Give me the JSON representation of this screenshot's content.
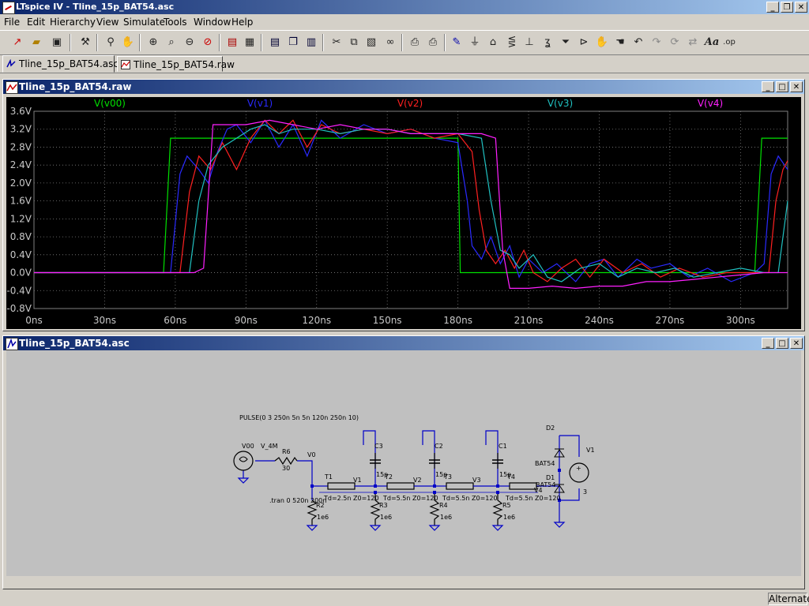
{
  "window": {
    "title": "LTspice IV - Tline_15p_BAT54.asc"
  },
  "menu": [
    "File",
    "Edit",
    "Hierarchy",
    "View",
    "Simulate",
    "Tools",
    "Window",
    "Help"
  ],
  "toolbar_icons": [
    "new-schematic-icon",
    "open-icon",
    "save-icon",
    "control-panel-icon",
    "run-icon",
    "halt-icon",
    "zoom-in-icon",
    "zoom-pan-icon",
    "zoom-out-icon",
    "zoom-full-icon",
    "autorange-icon",
    "grid-icon",
    "tile-horizontal-icon",
    "cascade-icon",
    "tile-vertical-icon",
    "cut-icon",
    "copy-icon",
    "paste-icon",
    "find-icon",
    "print-setup-icon",
    "print-icon",
    "draw-wire-icon",
    "ground-icon",
    "label-net-icon",
    "resistor-icon",
    "capacitor-icon",
    "inductor-icon",
    "diode-icon",
    "component-icon",
    "move-icon",
    "drag-icon",
    "undo-icon",
    "redo-icon",
    "rotate-icon",
    "mirror-icon",
    "text-icon",
    "spice-directive-icon"
  ],
  "tabs": [
    {
      "label": "Tline_15p_BAT54.asc",
      "active": true
    },
    {
      "label": "Tline_15p_BAT54.raw",
      "active": false
    }
  ],
  "plot_window": {
    "title": "Tline_15p_BAT54.raw"
  },
  "schematic_window": {
    "title": "Tline_15p_BAT54.asc"
  },
  "chart_data": {
    "type": "line",
    "x_unit": "ns",
    "xlim": [
      0,
      320
    ],
    "ylim": [
      -0.8,
      3.6
    ],
    "x_ticks": [
      "0ns",
      "30ns",
      "60ns",
      "90ns",
      "120ns",
      "150ns",
      "180ns",
      "210ns",
      "240ns",
      "270ns",
      "300ns"
    ],
    "y_ticks": [
      "3.6V",
      "3.2V",
      "2.8V",
      "2.4V",
      "2.0V",
      "1.6V",
      "1.2V",
      "0.8V",
      "0.4V",
      "0.0V",
      "-0.4V",
      "-0.8V"
    ],
    "grid": true,
    "legend_position": "top",
    "series": [
      {
        "name": "V(v00)",
        "color": "#00e000",
        "points": [
          [
            0,
            0
          ],
          [
            55,
            0
          ],
          [
            58,
            3.0
          ],
          [
            180,
            3.0
          ],
          [
            181,
            0
          ],
          [
            306,
            0
          ],
          [
            309,
            3.0
          ],
          [
            320,
            3.0
          ]
        ]
      },
      {
        "name": "V(v1)",
        "color": "#2a2aff",
        "points": [
          [
            0,
            0
          ],
          [
            58,
            0
          ],
          [
            62,
            2.2
          ],
          [
            65,
            2.6
          ],
          [
            70,
            2.3
          ],
          [
            74,
            2.0
          ],
          [
            78,
            2.7
          ],
          [
            82,
            3.2
          ],
          [
            86,
            3.3
          ],
          [
            92,
            2.9
          ],
          [
            98,
            3.4
          ],
          [
            104,
            2.8
          ],
          [
            110,
            3.3
          ],
          [
            116,
            2.6
          ],
          [
            122,
            3.4
          ],
          [
            130,
            3.0
          ],
          [
            140,
            3.3
          ],
          [
            150,
            3.1
          ],
          [
            160,
            3.2
          ],
          [
            170,
            3.0
          ],
          [
            180,
            2.9
          ],
          [
            184,
            1.6
          ],
          [
            186,
            0.6
          ],
          [
            190,
            0.3
          ],
          [
            194,
            0.8
          ],
          [
            198,
            0.2
          ],
          [
            202,
            0.6
          ],
          [
            206,
            -0.1
          ],
          [
            210,
            0.3
          ],
          [
            216,
            0.0
          ],
          [
            222,
            0.2
          ],
          [
            230,
            -0.2
          ],
          [
            236,
            0.2
          ],
          [
            242,
            0.3
          ],
          [
            248,
            -0.1
          ],
          [
            256,
            0.3
          ],
          [
            262,
            0.1
          ],
          [
            270,
            0.2
          ],
          [
            278,
            -0.1
          ],
          [
            286,
            0.1
          ],
          [
            296,
            -0.2
          ],
          [
            306,
            0.0
          ],
          [
            310,
            0.2
          ],
          [
            313,
            2.2
          ],
          [
            316,
            2.6
          ],
          [
            320,
            2.3
          ]
        ]
      },
      {
        "name": "V(v2)",
        "color": "#ff2020",
        "points": [
          [
            0,
            0
          ],
          [
            62,
            0
          ],
          [
            66,
            1.8
          ],
          [
            70,
            2.6
          ],
          [
            75,
            2.3
          ],
          [
            80,
            2.9
          ],
          [
            86,
            2.3
          ],
          [
            92,
            3.0
          ],
          [
            98,
            3.4
          ],
          [
            104,
            3.1
          ],
          [
            110,
            3.4
          ],
          [
            116,
            2.8
          ],
          [
            122,
            3.3
          ],
          [
            130,
            3.1
          ],
          [
            140,
            3.2
          ],
          [
            150,
            3.1
          ],
          [
            160,
            3.2
          ],
          [
            170,
            3.0
          ],
          [
            180,
            3.1
          ],
          [
            186,
            2.7
          ],
          [
            189,
            1.4
          ],
          [
            192,
            0.5
          ],
          [
            196,
            0.2
          ],
          [
            200,
            0.5
          ],
          [
            204,
            0.1
          ],
          [
            208,
            0.5
          ],
          [
            212,
            0.0
          ],
          [
            218,
            -0.2
          ],
          [
            224,
            0.1
          ],
          [
            230,
            0.3
          ],
          [
            236,
            -0.1
          ],
          [
            242,
            0.3
          ],
          [
            250,
            0.0
          ],
          [
            258,
            0.2
          ],
          [
            266,
            -0.1
          ],
          [
            274,
            0.1
          ],
          [
            284,
            -0.1
          ],
          [
            294,
            0.0
          ],
          [
            304,
            0.0
          ],
          [
            312,
            0.0
          ],
          [
            315,
            1.6
          ],
          [
            318,
            2.3
          ],
          [
            320,
            2.5
          ]
        ]
      },
      {
        "name": "V(v3)",
        "color": "#20c0c0",
        "points": [
          [
            0,
            0
          ],
          [
            66,
            0
          ],
          [
            70,
            1.6
          ],
          [
            74,
            2.4
          ],
          [
            80,
            2.8
          ],
          [
            86,
            3.0
          ],
          [
            92,
            3.2
          ],
          [
            98,
            3.3
          ],
          [
            104,
            3.1
          ],
          [
            110,
            3.2
          ],
          [
            120,
            3.2
          ],
          [
            130,
            3.1
          ],
          [
            140,
            3.2
          ],
          [
            150,
            3.2
          ],
          [
            160,
            3.1
          ],
          [
            170,
            3.1
          ],
          [
            180,
            3.1
          ],
          [
            190,
            3.0
          ],
          [
            194,
            1.6
          ],
          [
            198,
            0.5
          ],
          [
            202,
            0.4
          ],
          [
            206,
            0.1
          ],
          [
            212,
            0.4
          ],
          [
            218,
            -0.1
          ],
          [
            224,
            -0.2
          ],
          [
            232,
            0.1
          ],
          [
            240,
            0.2
          ],
          [
            248,
            -0.1
          ],
          [
            256,
            0.1
          ],
          [
            264,
            0.0
          ],
          [
            272,
            0.1
          ],
          [
            280,
            -0.1
          ],
          [
            290,
            0.0
          ],
          [
            300,
            0.1
          ],
          [
            310,
            0.0
          ],
          [
            316,
            0.0
          ],
          [
            320,
            1.6
          ]
        ]
      },
      {
        "name": "V(v4)",
        "color": "#ff20ff",
        "points": [
          [
            0,
            0
          ],
          [
            68,
            0
          ],
          [
            72,
            0.1
          ],
          [
            76,
            3.3
          ],
          [
            90,
            3.3
          ],
          [
            100,
            3.4
          ],
          [
            110,
            3.3
          ],
          [
            120,
            3.2
          ],
          [
            130,
            3.3
          ],
          [
            140,
            3.2
          ],
          [
            150,
            3.2
          ],
          [
            160,
            3.1
          ],
          [
            170,
            3.1
          ],
          [
            180,
            3.1
          ],
          [
            190,
            3.1
          ],
          [
            196,
            3.0
          ],
          [
            199,
            0.5
          ],
          [
            202,
            -0.35
          ],
          [
            210,
            -0.35
          ],
          [
            220,
            -0.3
          ],
          [
            230,
            -0.35
          ],
          [
            240,
            -0.3
          ],
          [
            250,
            -0.3
          ],
          [
            260,
            -0.2
          ],
          [
            270,
            -0.2
          ],
          [
            280,
            -0.15
          ],
          [
            290,
            -0.1
          ],
          [
            300,
            -0.05
          ],
          [
            310,
            0.0
          ],
          [
            320,
            0.0
          ]
        ]
      }
    ]
  },
  "schematic": {
    "pulse_directive": "PULSE(0 3 250n 5n 5n 120n 250n 10)",
    "tran_directive": ".tran 0 520n 200n",
    "labels": {
      "v00": "V00",
      "v_4m": "V_4M",
      "r6": "R6",
      "r6v": "30",
      "v0": "V0",
      "t1": "T1",
      "t1v": "Td=2.5n Z0=120",
      "v1": "V1",
      "t2": "T2",
      "t2v": "Td=5.5n Z0=120",
      "v2": "V2",
      "t3": "T3",
      "t3v": "Td=5.5n Z0=120",
      "v3": "V3",
      "t4": "T4",
      "t4v": "Td=5.5n Z0=120",
      "v4": "V4",
      "c3": "C3",
      "c3v": "15p",
      "c2": "C2",
      "c2v": "15p",
      "c1": "C1",
      "c1v": "15p",
      "r2": "R2",
      "r2v": "1e6",
      "r3": "R3",
      "r3v": "1e6",
      "r4": "R4",
      "r4v": "1e6",
      "r5": "R5",
      "r5v": "1e6",
      "d2": "D2",
      "d2v": "BAT54",
      "d1": "D1",
      "d1v": "BAT54",
      "vsrc1": "V1",
      "vsrc1v": "3"
    }
  },
  "status": {
    "mode": "Alternate"
  },
  "colors": {
    "titlebar_start": "#0a246a",
    "titlebar_end": "#a6caf0",
    "plot_bg": "#000000",
    "grid": "#808080",
    "wire": "#0000c8"
  }
}
